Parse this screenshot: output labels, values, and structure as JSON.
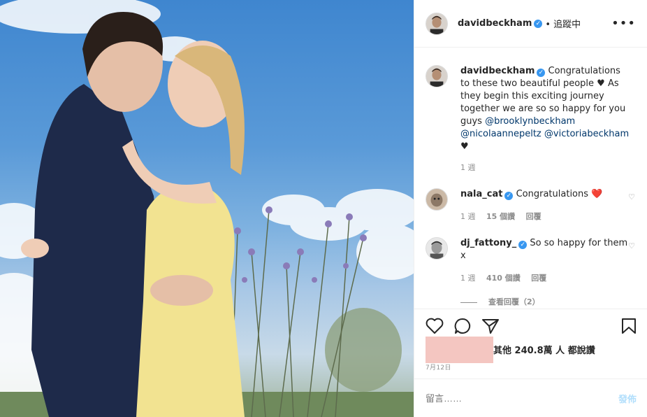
{
  "header": {
    "username": "davidbeckham",
    "follow_status": "• 追蹤中",
    "more_icon": "more-dots-icon"
  },
  "caption": {
    "username": "davidbeckham",
    "text": "Congratulations to these two beautiful people ♥ As they begin this exciting journey together we are so so happy for you guys",
    "mentions": [
      "@brooklynbeckham",
      "@nicolaannepeltz",
      "@victoriabeckham"
    ],
    "trailing": "♥",
    "time": "1 週"
  },
  "comments": [
    {
      "username": "nala_cat",
      "text": "Congratulations",
      "emoji": "❤️",
      "time": "1 週",
      "likes": "15 個讚",
      "reply": "回覆"
    },
    {
      "username": "dj_fattony_",
      "text": "So so happy for them x",
      "time": "1 週",
      "likes": "410 個讚",
      "reply": "回覆"
    }
  ],
  "view_replies": "查看回覆（2）",
  "likes_text": "其他 240.8萬 人 都說讚",
  "date": "7月12日",
  "add_comment": {
    "placeholder": "留言……",
    "post_label": "發佈"
  },
  "colors": {
    "verified": "#3897f0",
    "mention": "#00376b",
    "post_disabled": "#b2dffc",
    "redacted": "#f4c6c1"
  }
}
